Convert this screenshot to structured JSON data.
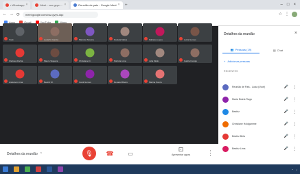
{
  "browser": {
    "tabs": [
      {
        "label": "• Whatsapp",
        "active": false
      },
      {
        "label": "Meet - vuz-gvyc-...",
        "active": false
      },
      {
        "label": "Reunião de pais - Google Meet",
        "active": true
      },
      {
        "label": "+",
        "active": false
      }
    ],
    "url": "meet.google.com/vuz-gvyc-dqc",
    "bookmarks": [
      "Apps",
      "Gmail",
      "YouTube",
      "Maps"
    ]
  },
  "meeting": {
    "details_label": "Detalhes da reunião",
    "present_label": "Apresentar agora",
    "tiles": [
      {
        "name": "Você",
        "color": "#5f6368"
      },
      {
        "name": "Lucia M. Garcia",
        "color": "#8d6e63"
      },
      {
        "name": "Marcela Teixeira",
        "color": "#7e57c2"
      },
      {
        "name": "Daniela Matos",
        "color": "#a1887f"
      },
      {
        "name": "Fabiana Lopes",
        "color": "#c2185b"
      },
      {
        "name": "Luiza Gomes",
        "color": "#795548"
      },
      {
        "name": "Clarissa Rocha",
        "color": "#e53935"
      },
      {
        "name": "Mauro Siqueira",
        "color": "#6d4c41"
      },
      {
        "name": "Christiane D.",
        "color": "#7cb342"
      },
      {
        "name": "Patrícia Lima",
        "color": "#8d6e63"
      },
      {
        "name": "Julia Mello",
        "color": "#a1887f"
      },
      {
        "name": "Gabriel Araújo",
        "color": "#8d6e63"
      },
      {
        "name": "Anderson Lima",
        "color": "#e53935"
      },
      {
        "name": "Beatriz M.",
        "color": "#5c6bc0"
      },
      {
        "name": "Carol Gomes",
        "color": "#8e24aa"
      },
      {
        "name": "Renata Ribeiro",
        "color": "#ab47bc"
      },
      {
        "name": "Marina Souza",
        "color": "#e57373"
      }
    ]
  },
  "panel": {
    "title": "Detalhes da reunião",
    "tab_people": "Pessoas (19)",
    "tab_chat": "Chat",
    "add_people": "Adicionar pessoas",
    "section_label": "RECENTES",
    "people": [
      {
        "name": "Reunião de Pais - Lúcia (Você)",
        "color": "#5c6bc0"
      },
      {
        "name": "Maria Estela Tiago",
        "color": "#8e24aa"
      },
      {
        "name": "Beatriz",
        "color": "#1e88e5"
      },
      {
        "name": "Christiane Holdgamme",
        "color": "#ef6c00"
      },
      {
        "name": "Beatriz Bela",
        "color": "#e53935"
      },
      {
        "name": "Beatriz Lima",
        "color": "#d81b60"
      }
    ]
  },
  "colors": {
    "accent": "#1a73e8",
    "end_call": "#e94235",
    "stage_bg": "#202124"
  }
}
